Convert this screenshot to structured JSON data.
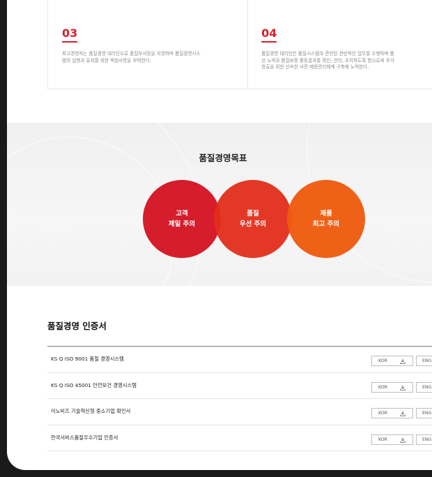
{
  "policies": [
    {
      "num": "03",
      "text": "최고경영자는 품질경영 대리인으로 품질부서장을 지명하며 품질경영시스\n템의 실행과 유지를 위한 책임사항을 부여한다."
    },
    {
      "num": "04",
      "text": "품질경영 대리인은 품질시스템과 관련된 전반적인 업무를 수행하며 품\n선 노력과 품질보증 활동결과를 확인, 관리, 조치하도록 함으로써 부가\n창출을 위한 신속한 사전 예방관리체계 구축에 노력한다."
    }
  ],
  "goals": {
    "title": "품질경영목표",
    "circles": [
      {
        "line1": "고객",
        "line2": "제일 주의",
        "color": "#d61d2b"
      },
      {
        "line1": "품질",
        "line2": "우선 주의",
        "color": "#e22d1a"
      },
      {
        "line1": "제품",
        "line2": "최고 주의",
        "color": "#ee5c0f"
      }
    ]
  },
  "certificates": {
    "title": "품질경영 인증서",
    "kor_label": "KOR",
    "eng_label": "ENG",
    "download_icon": "download-icon",
    "items": [
      "KS Q ISO 9001 품질 경영시스템",
      "KS Q ISO 45001 안전보건 경영시스템",
      "이노비즈 기술혁신형 중소기업 확인서",
      "한국서비스품질우수기업 인증서"
    ]
  }
}
